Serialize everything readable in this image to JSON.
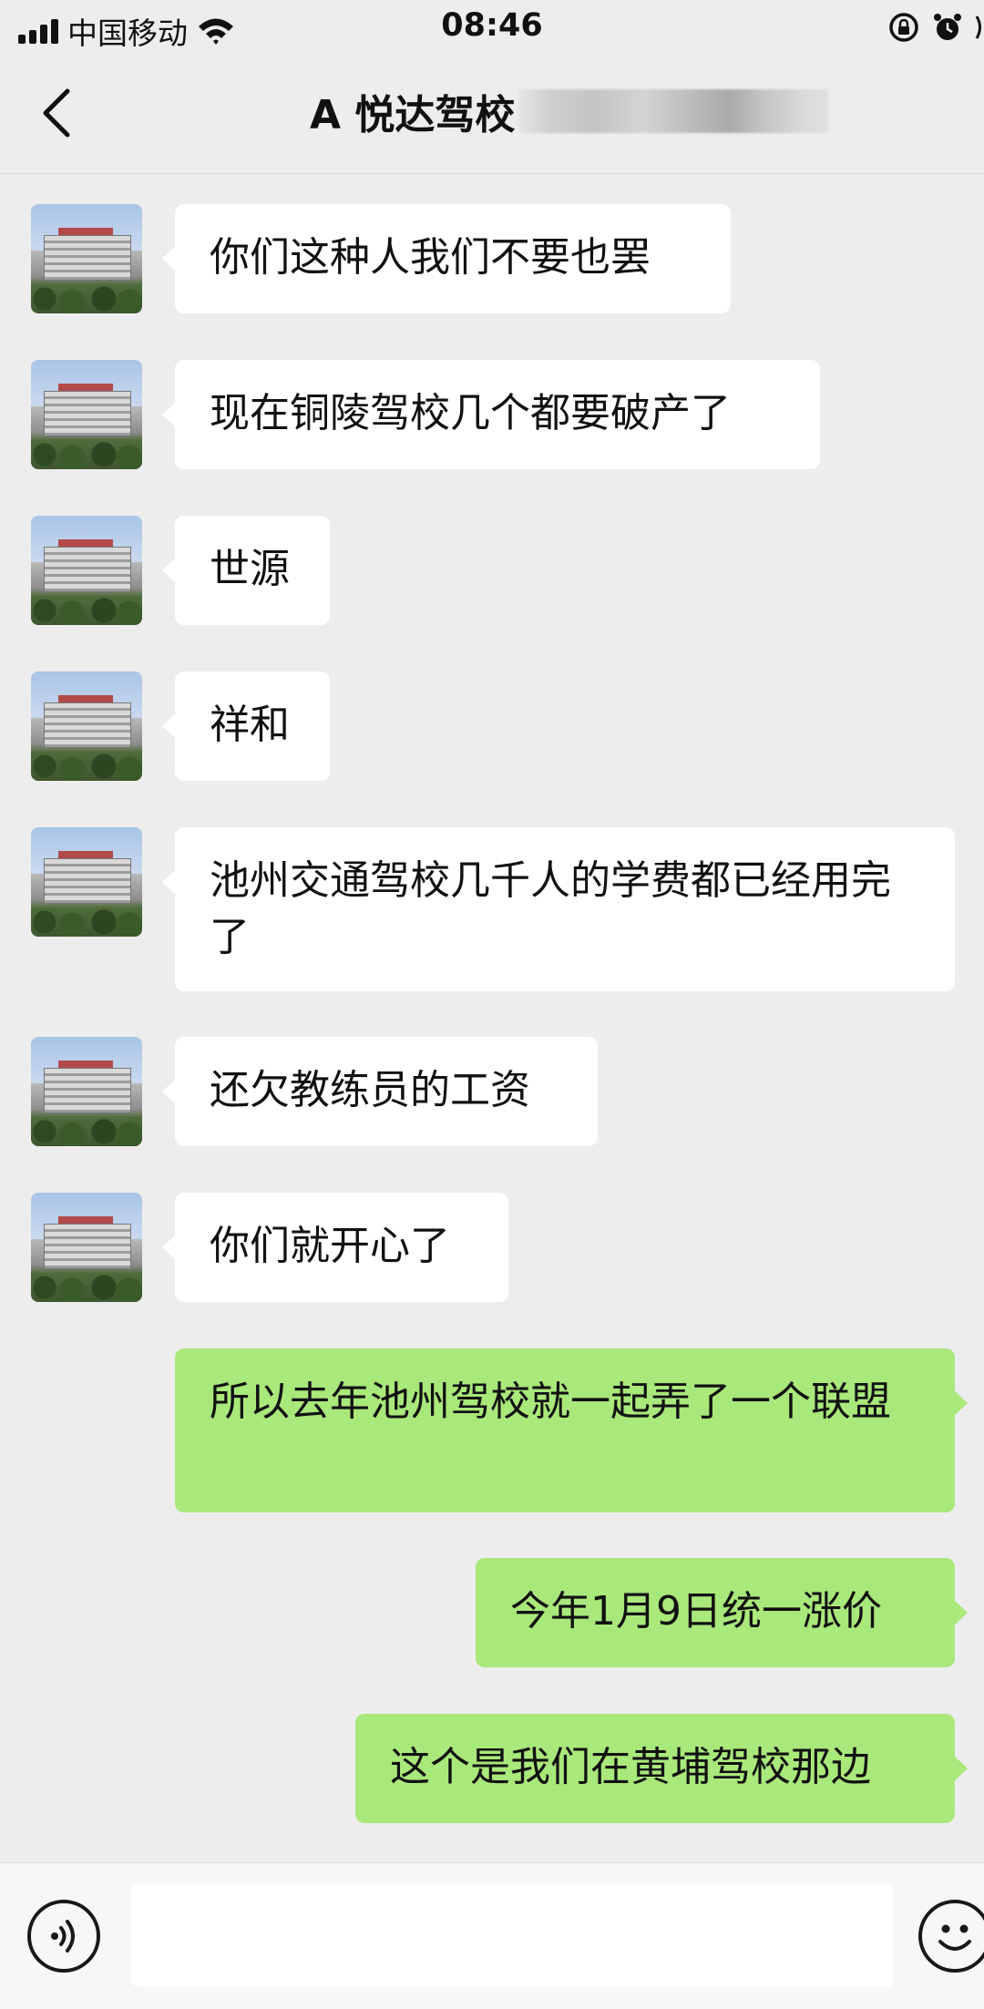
{
  "status_bar": {
    "carrier": "中国移动",
    "time": "08:46"
  },
  "header": {
    "title": "A 悦达驾校"
  },
  "messages": [
    {
      "side": "left",
      "text": "你们这种人我们不要也罢"
    },
    {
      "side": "left",
      "text": "现在铜陵驾校几个都要破产了"
    },
    {
      "side": "left",
      "text": "世源"
    },
    {
      "side": "left",
      "text": "祥和"
    },
    {
      "side": "left",
      "text": "池州交通驾校几千人的学费都已经用完了"
    },
    {
      "side": "left",
      "text": "还欠教练员的工资"
    },
    {
      "side": "left",
      "text": "你们就开心了"
    },
    {
      "side": "right",
      "text": "所以去年池州驾校就一起弄了一个联盟"
    },
    {
      "side": "right",
      "text": "今年1月9日统一涨价"
    },
    {
      "side": "right",
      "text": "这个是我们在黄埔驾校那边"
    }
  ],
  "input": {
    "value": ""
  },
  "icons": {
    "back": "chevron-left-icon",
    "voice": "voice-icon",
    "emoji": "emoji-icon",
    "wifi": "wifi-icon",
    "lock": "rotation-lock-icon",
    "alarm": "alarm-icon"
  },
  "colors": {
    "background": "#ededed",
    "incoming_bubble": "#ffffff",
    "outgoing_bubble": "#a9e87a"
  }
}
